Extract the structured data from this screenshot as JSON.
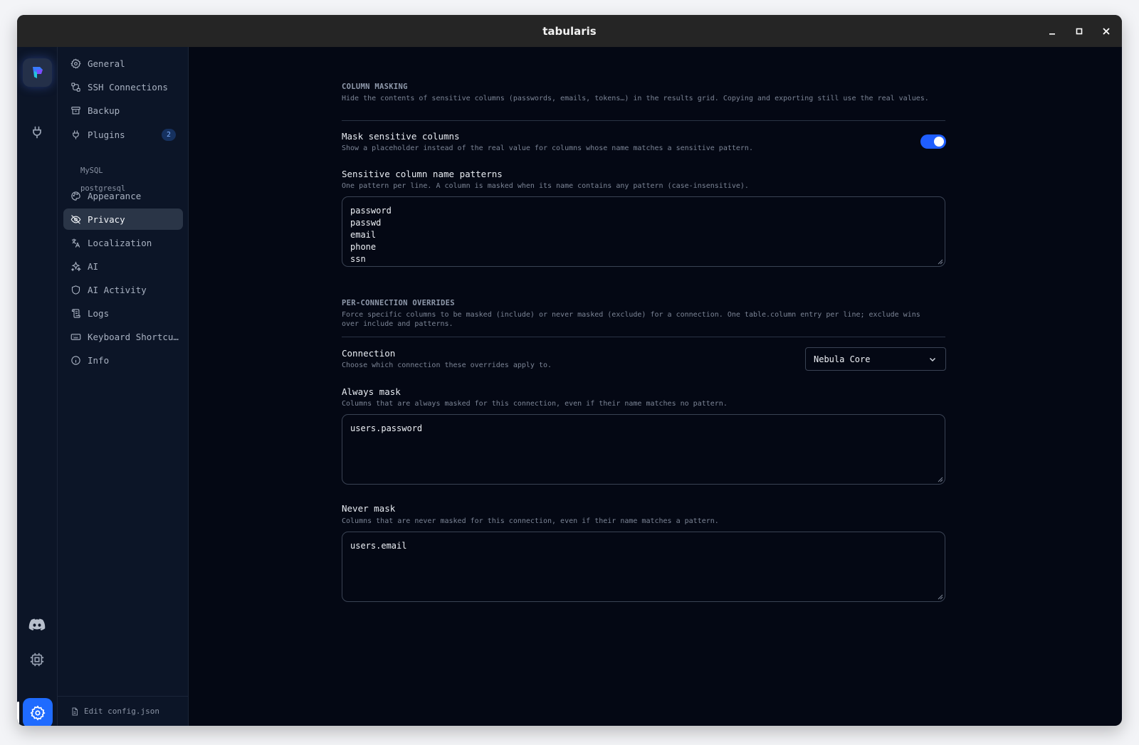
{
  "window": {
    "title": "tabularis"
  },
  "sidebar": {
    "items": [
      {
        "label": "General"
      },
      {
        "label": "SSH Connections"
      },
      {
        "label": "Backup"
      },
      {
        "label": "Plugins",
        "badge": "2"
      },
      {
        "label": "Appearance"
      },
      {
        "label": "Privacy"
      },
      {
        "label": "Localization"
      },
      {
        "label": "AI"
      },
      {
        "label": "AI Activity"
      },
      {
        "label": "Logs"
      },
      {
        "label": "Keyboard Shortcuts"
      },
      {
        "label": "Info"
      }
    ],
    "plugins": [
      "MySQL",
      "postgresql"
    ],
    "footer": "Edit config.json"
  },
  "column_masking": {
    "title": "COLUMN MASKING",
    "description": "Hide the contents of sensitive columns (passwords, emails, tokens…) in the results grid. Copying and exporting still use the real values.",
    "mask_label": "Mask sensitive columns",
    "mask_desc": "Show a placeholder instead of the real value for columns whose name matches a sensitive pattern.",
    "mask_enabled": true,
    "patterns_label": "Sensitive column name patterns",
    "patterns_desc": "One pattern per line. A column is masked when its name contains any pattern (case-insensitive).",
    "patterns": [
      "password",
      "passwd",
      "email",
      "phone",
      "ssn"
    ]
  },
  "overrides": {
    "title": "PER-CONNECTION OVERRIDES",
    "description": "Force specific columns to be masked (include) or never masked (exclude) for a connection. One table.column entry per line; exclude wins over include and patterns.",
    "connection_label": "Connection",
    "connection_desc": "Choose which connection these overrides apply to.",
    "connection_value": "Nebula Core",
    "always_label": "Always mask",
    "always_desc": "Columns that are always masked for this connection, even if their name matches no pattern.",
    "always_value": "users.password",
    "never_label": "Never mask",
    "never_desc": "Columns that are never masked for this connection, even if their name matches a pattern.",
    "never_value": "users.email"
  },
  "colors": {
    "accent": "#1f6bff",
    "background": "#040814",
    "sidebar": "#0c1527"
  }
}
